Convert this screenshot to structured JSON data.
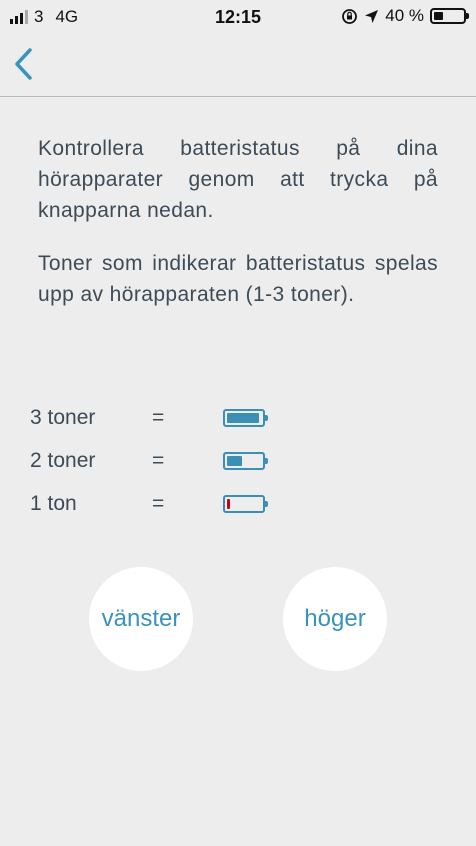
{
  "status_bar": {
    "carrier": "3",
    "network": "4G",
    "time": "12:15",
    "battery_text": "40 %",
    "battery_level": 0.4
  },
  "nav": {
    "back_icon": "chevron-left-icon"
  },
  "content": {
    "paragraph1": "Kontrollera batteristatus på dina hörapparater genom att trycka på knapparna nedan.",
    "paragraph2": "Toner som indikerar batteristatus spelas upp av hörapparaten (1-3 toner)."
  },
  "legend": [
    {
      "label": "3 toner",
      "equals": "=",
      "level": 0.95,
      "color": "#3c8fb4"
    },
    {
      "label": "2 toner",
      "equals": "=",
      "level": 0.5,
      "color": "#3c8fb4"
    },
    {
      "label": "1 ton",
      "equals": "=",
      "level": 0.1,
      "color": "#d0021b"
    }
  ],
  "buttons": {
    "left": "vänster",
    "right": "höger"
  },
  "colors": {
    "accent": "#3a93b8",
    "background": "#ededed",
    "low_battery": "#d0021b"
  }
}
